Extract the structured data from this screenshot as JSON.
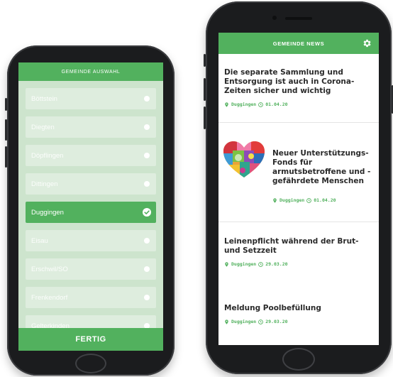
{
  "left_app": {
    "header_title": "GEMEINDE AUSWAHL",
    "municipalities": [
      {
        "name": "Böttstein",
        "selected": false
      },
      {
        "name": "Diegten",
        "selected": false
      },
      {
        "name": "Döpflingen",
        "selected": false
      },
      {
        "name": "Dittingen",
        "selected": false
      },
      {
        "name": "Duggingen",
        "selected": true
      },
      {
        "name": "Eisau",
        "selected": false
      },
      {
        "name": "Erschwil/SO",
        "selected": false
      },
      {
        "name": "Frenkendorf",
        "selected": false
      },
      {
        "name": "Gelterkinden",
        "selected": false
      }
    ],
    "done_label": "FERTIG"
  },
  "right_app": {
    "header_title": "GEMEINDE NEWS",
    "settings_icon": "gear-icon",
    "news": [
      {
        "title": "Die separate Sammlung und Entsorgung ist auch in Corona-Zeiten sicher und wichtig",
        "location": "Duggingen",
        "date": "01.04.20"
      },
      {
        "title": "Neuer Unterstützungs-Fonds für armutsbetroffene und -gefährdete Menschen",
        "location": "Duggingen",
        "date": "01.04.20",
        "image": "heart-icon"
      },
      {
        "title": "Leinenpflicht während der Brut- und Setzzeit",
        "location": "Duggingen",
        "date": "29.03.20"
      },
      {
        "title": "Meldung Poolbefüllung",
        "location": "Duggingen",
        "date": "29.03.20"
      }
    ]
  },
  "colors": {
    "accent": "#52b15e",
    "list_bg": "#cde4cd",
    "item_bg": "#deedde",
    "title_text": "#2a2a2a"
  }
}
